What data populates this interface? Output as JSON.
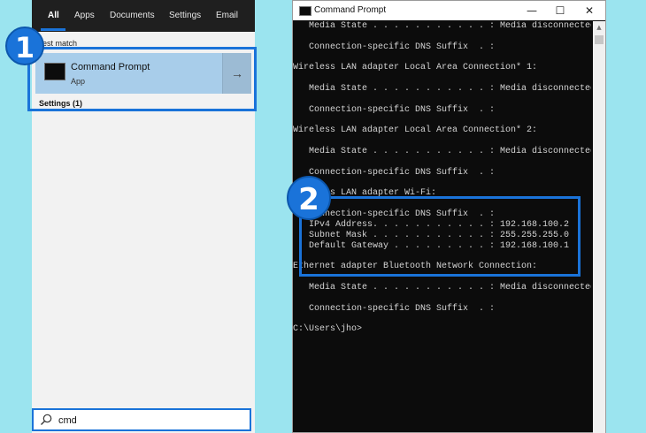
{
  "start_menu": {
    "tabs": [
      {
        "label": "All",
        "active": true
      },
      {
        "label": "Apps"
      },
      {
        "label": "Documents"
      },
      {
        "label": "Settings"
      },
      {
        "label": "Email"
      }
    ],
    "best_match_label": "Best match",
    "result": {
      "title": "Command Prompt",
      "subtitle": "App",
      "arrow": "→"
    },
    "settings_label": "Settings (1)",
    "search": {
      "value": "cmd"
    }
  },
  "badges": {
    "step1": "1",
    "step2": "2"
  },
  "cmd": {
    "title": "Command Prompt",
    "controls": {
      "minimize": "—",
      "maximize": "☐",
      "close": "✕"
    },
    "lines": [
      "   Media State . . . . . . . . . . . : Media disconnected",
      "   Connection-specific DNS Suffix  . :",
      "Wireless LAN adapter Local Area Connection* 1:",
      "   Media State . . . . . . . . . . . : Media disconnected",
      "   Connection-specific DNS Suffix  . :",
      "Wireless LAN adapter Local Area Connection* 2:",
      "   Media State . . . . . . . . . . . : Media disconnected",
      "   Connection-specific DNS Suffix  . :",
      "Wireless LAN adapter Wi-Fi:",
      "   Connection-specific DNS Suffix  . :",
      "   IPv4 Address. . . . . . . . . . . : 192.168.100.2",
      "   Subnet Mask . . . . . . . . . . . : 255.255.255.0",
      "   Default Gateway . . . . . . . . . : 192.168.100.1",
      "Ethernet adapter Bluetooth Network Connection:",
      "   Media State . . . . . . . . . . . : Media disconnected",
      "   Connection-specific DNS Suffix  . :",
      "C:\\Users\\jho>"
    ]
  },
  "colors": {
    "accent": "#1a73d9",
    "background": "#9be4ef",
    "selection": "#a8cdea",
    "terminal_bg": "#0c0c0c"
  }
}
